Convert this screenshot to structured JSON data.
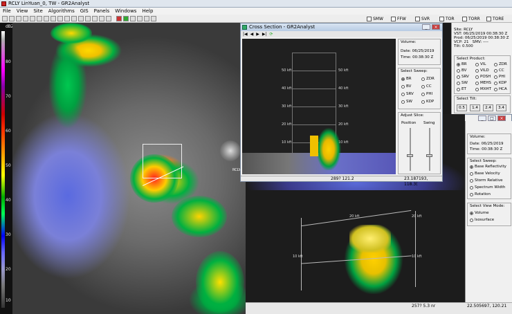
{
  "app": {
    "title": "RCLY LinYuan_0, TW - GR2Analyst"
  },
  "menu": [
    "File",
    "View",
    "Site",
    "Algorithms",
    "GIS",
    "Panels",
    "Windows",
    "Help"
  ],
  "warnings": [
    "SMW",
    "FFW",
    "SVR",
    "TOR",
    "TORR",
    "TORE"
  ],
  "palette": {
    "unit": "dBZ",
    "ticks": [
      "80",
      "70",
      "60",
      "50",
      "40",
      "30",
      "20",
      "10"
    ]
  },
  "radar": {
    "label": "RCLY"
  },
  "site_info": {
    "site_label": "Site:",
    "site": "RCLY",
    "vst_label": "VST:",
    "vst": "06/25/2019 00:38:30 Z",
    "prod_label": "Prod:",
    "prod": "06/25/2019 00:38:30 Z",
    "vcp_label": "VCP:",
    "vcp": "21",
    "smv_label": "SMV:",
    "smv": "----",
    "tilt_label": "Tilt:",
    "tilt": "0.500"
  },
  "select_product": {
    "title": "Select Product:",
    "items": [
      "BR",
      "BV",
      "SRV",
      "SW",
      "ET",
      "VIL",
      "VILD",
      "POSH",
      "MEHS",
      "MXHT",
      "ZDR",
      "CC",
      "PHI",
      "KDP",
      "HCA"
    ],
    "selected": "BR"
  },
  "select_tilt": {
    "title": "Select Tilt:",
    "values": [
      "0.5",
      "1.4",
      "2.4",
      "3.4"
    ]
  },
  "cross_section": {
    "title": "Cross Section - GR2Analyst",
    "heights": [
      "50 kft",
      "40 kft",
      "30 kft",
      "20 kft",
      "10 kft"
    ],
    "volume_title": "Volume:",
    "date_label": "Date:",
    "date": "06/25/2019",
    "time_label": "Time:",
    "time": "00:38:30 Z",
    "sweep_title": "Select Sweep:",
    "sweeps": [
      "BR",
      "BV",
      "SRV",
      "SW",
      "ZDR",
      "CC",
      "PHI",
      "KDP"
    ],
    "sweep_selected": "BR",
    "adjust_title": "Adjust Slice:",
    "position_label": "Position",
    "swing_label": "Swing",
    "status_left": "289? 121.2",
    "status_right": "23.187193, 118.3("
  },
  "volume3d": {
    "heights_left": [
      "10 kft"
    ],
    "heights_right": [
      "20 kft",
      "10 kft"
    ],
    "height_mid": "20 kft",
    "volume_title": "Volume:",
    "date_label": "Date:",
    "date": "06/25/2019",
    "time_label": "Time:",
    "time": "00:38:30 Z",
    "sweep_title": "Select Sweep:",
    "sweeps": [
      "Base Reflectivity",
      "Base Velocity",
      "Storm Relative",
      "Spectrum Width",
      "Rotation"
    ],
    "sweep_selected": "Base Reflectivity",
    "view_title": "Select View Mode:",
    "views": [
      "Volume",
      "Isosurface"
    ],
    "view_selected": "Volume",
    "status_left": "257? 5.3 nr",
    "status_right": "22.505697, 120.21"
  }
}
